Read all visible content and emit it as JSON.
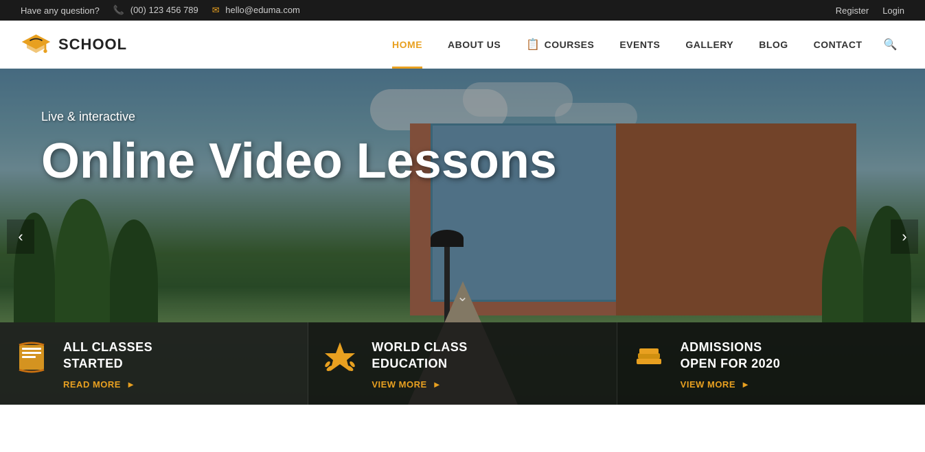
{
  "topbar": {
    "question": "Have any question?",
    "phone": "(00) 123 456 789",
    "email": "hello@eduma.com",
    "register": "Register",
    "login": "Login"
  },
  "header": {
    "logo_text": "SCHOOL",
    "nav": [
      {
        "id": "home",
        "label": "HOME",
        "active": true
      },
      {
        "id": "about",
        "label": "ABOUT US",
        "active": false
      },
      {
        "id": "courses",
        "label": "COURSES",
        "active": false,
        "has_icon": true
      },
      {
        "id": "events",
        "label": "EVENTS",
        "active": false
      },
      {
        "id": "gallery",
        "label": "GALLERY",
        "active": false
      },
      {
        "id": "blog",
        "label": "BLOG",
        "active": false
      },
      {
        "id": "contact",
        "label": "CONTACT",
        "active": false
      }
    ]
  },
  "hero": {
    "subtitle": "Live & interactive",
    "title": "Online Video Lessons"
  },
  "cards": [
    {
      "id": "classes",
      "title": "ALL CLASSES\nSTARTED",
      "link_label": "READ MORE",
      "icon": "📖"
    },
    {
      "id": "education",
      "title": "WORLD CLASS\nEDUCATION",
      "link_label": "VIEW MORE",
      "icon": "⭐"
    },
    {
      "id": "admissions",
      "title": "ADMISSIONS\nOPEN FOR 2020",
      "link_label": "VIEW MORE",
      "icon": "📚"
    }
  ]
}
